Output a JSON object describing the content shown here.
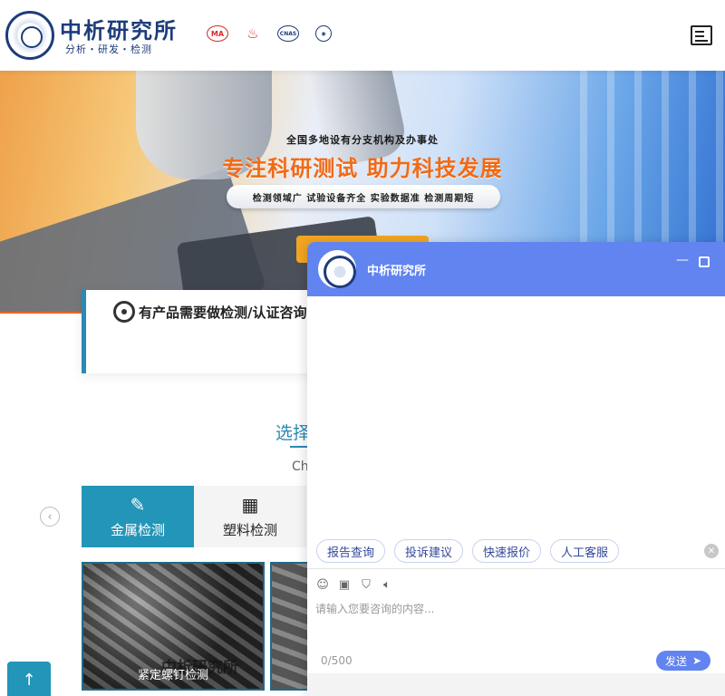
{
  "header": {
    "brand_name": "中析研究所",
    "brand_tagline": "分析・研发・检测",
    "certs": [
      "MA",
      "CNAS"
    ],
    "menu_icon": "menu-list-icon"
  },
  "banner": {
    "top_line": "全国多地设有分支机构及办事处",
    "headline": "专注科研测试 助力科技发展",
    "features": "检测领域广  试验设备齐全  实验数据准 检测周期短"
  },
  "consult": {
    "text": "有产品需要做检测/认证咨询"
  },
  "section": {
    "title": "选择",
    "subtitle": "Ch"
  },
  "tabs": [
    {
      "label": "金属检测",
      "icon": "metal-test-icon",
      "active": true
    },
    {
      "label": "塑料检测",
      "icon": "plastic-test-icon",
      "active": false
    }
  ],
  "products": [
    {
      "label": "紧定螺钉检测",
      "watermark": "中析研究所"
    }
  ],
  "chat": {
    "title": "中析研究所",
    "quick_replies": [
      "报告查询",
      "投诉建议",
      "快速报价",
      "人工客服"
    ],
    "input_placeholder": "请输入您要咨询的内容...",
    "char_count": "0/500",
    "send_label": "发送"
  },
  "colors": {
    "brand_blue": "#1d3c7a",
    "accent_teal": "#2395b8",
    "chat_blue": "#6184f0",
    "banner_orange": "#f26a14"
  }
}
